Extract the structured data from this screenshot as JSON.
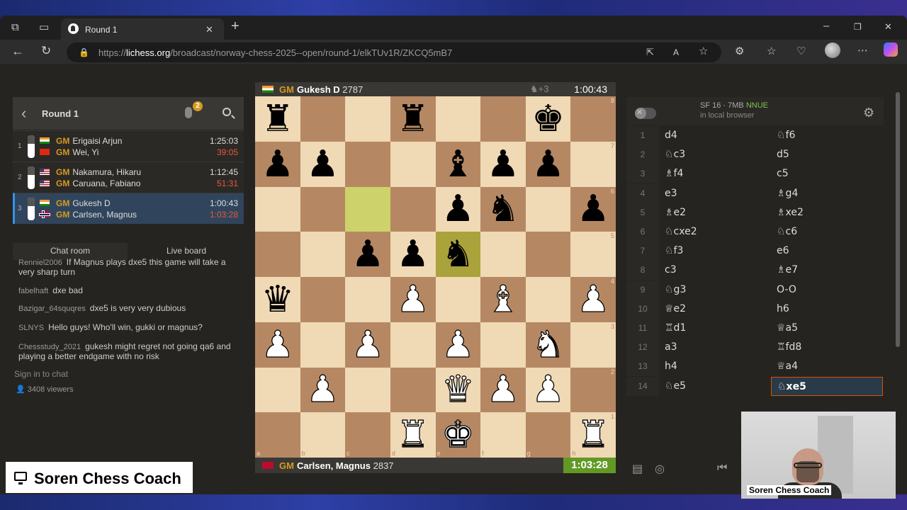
{
  "browser": {
    "tab_title": "Round 1",
    "url_prefix": "https://",
    "url_host": "lichess.org",
    "url_path": "/broadcast/norway-chess-2025--open/round-1/elkTUv1R/ZKCQ5mB7"
  },
  "sidebar": {
    "title": "Round 1",
    "mic_badge": "2",
    "games": [
      {
        "num": "1",
        "white": {
          "title": "GM",
          "name": "Erigaisi Arjun",
          "clock": "1:25:03"
        },
        "black": {
          "title": "GM",
          "name": "Wei, Yi",
          "clock": "39:05"
        }
      },
      {
        "num": "2",
        "white": {
          "title": "GM",
          "name": "Nakamura, Hikaru",
          "clock": "1:12:45"
        },
        "black": {
          "title": "GM",
          "name": "Caruana, Fabiano",
          "clock": "51:31"
        }
      },
      {
        "num": "3",
        "white": {
          "title": "GM",
          "name": "Gukesh D",
          "clock": "1:00:43"
        },
        "black": {
          "title": "GM",
          "name": "Carlsen, Magnus",
          "clock": "1:03:28"
        }
      }
    ]
  },
  "chat": {
    "tab_room": "Chat room",
    "tab_live": "Live board",
    "messages": [
      {
        "user": "Renniel2006",
        "text": "If Magnus plays dxe5 this game will take a very sharp turn"
      },
      {
        "user": "fabelhaft",
        "text": "dxe bad"
      },
      {
        "user": "Bazigar_64squqres",
        "text": "dxe5 is very very dubious"
      },
      {
        "user": "SLNYS",
        "text": "Hello guys! Who'll win, gukki or magnus?"
      },
      {
        "user": "Chessstudy_2021",
        "text": "gukesh might regret not going qa6 and playing a better endgame with no risk"
      }
    ],
    "sign_in": "Sign in to chat",
    "viewers": "3408 viewers"
  },
  "board": {
    "top": {
      "title": "GM",
      "name": "Gukesh D",
      "rating": "2787",
      "material": "+3",
      "clock": "1:00:43"
    },
    "bottom": {
      "title": "GM",
      "name": "Carlsen, Magnus",
      "rating": "2837",
      "clock": "1:03:28"
    },
    "ranks": [
      "8",
      "7",
      "6",
      "5",
      "4",
      "3",
      "2",
      "1"
    ],
    "files": [
      "a",
      "b",
      "c",
      "d",
      "e",
      "f",
      "g",
      "h"
    ],
    "position": [
      [
        "br",
        "",
        "",
        "br",
        "",
        "",
        "bk",
        ""
      ],
      [
        "bp",
        "bp",
        "",
        "",
        "bb",
        "bp",
        "bp",
        ""
      ],
      [
        "",
        "",
        "",
        "",
        "bp",
        "bn",
        "",
        "bp"
      ],
      [
        "",
        "",
        "bp",
        "bp",
        "bn",
        "",
        "",
        ""
      ],
      [
        "bq",
        "",
        "",
        "wp",
        "",
        "wb",
        "",
        "wp"
      ],
      [
        "wp",
        "",
        "wp",
        "",
        "wp",
        "",
        "wn",
        ""
      ],
      [
        "",
        "wp",
        "",
        "",
        "wq",
        "wp",
        "wp",
        ""
      ],
      [
        "",
        "",
        "",
        "wr",
        "wk",
        "",
        "",
        "wr"
      ]
    ],
    "highlights": [
      [
        2,
        2
      ],
      [
        3,
        4
      ]
    ]
  },
  "engine": {
    "name": "SF 16 · 7MB",
    "nnue": "NNUE",
    "sub": "in local browser"
  },
  "moves": [
    {
      "n": "1",
      "w": "d4",
      "b": "♘f6"
    },
    {
      "n": "2",
      "w": "♘c3",
      "b": "d5"
    },
    {
      "n": "3",
      "w": "♗f4",
      "b": "c5"
    },
    {
      "n": "4",
      "w": "e3",
      "b": "♗g4"
    },
    {
      "n": "5",
      "w": "♗e2",
      "b": "♗xe2"
    },
    {
      "n": "6",
      "w": "♘cxe2",
      "b": "♘c6"
    },
    {
      "n": "7",
      "w": "♘f3",
      "b": "e6"
    },
    {
      "n": "8",
      "w": "c3",
      "b": "♗e7"
    },
    {
      "n": "9",
      "w": "♘g3",
      "b": "O-O"
    },
    {
      "n": "10",
      "w": "♕e2",
      "b": "h6"
    },
    {
      "n": "11",
      "w": "♖d1",
      "b": "♕a5"
    },
    {
      "n": "12",
      "w": "a3",
      "b": "♖fd8"
    },
    {
      "n": "13",
      "w": "h4",
      "b": "♕a4"
    },
    {
      "n": "14",
      "w": "♘e5",
      "b": "♘xe5"
    }
  ],
  "overlay": {
    "brand": "Soren Chess Coach",
    "cam_label": "Soren Chess Coach"
  }
}
